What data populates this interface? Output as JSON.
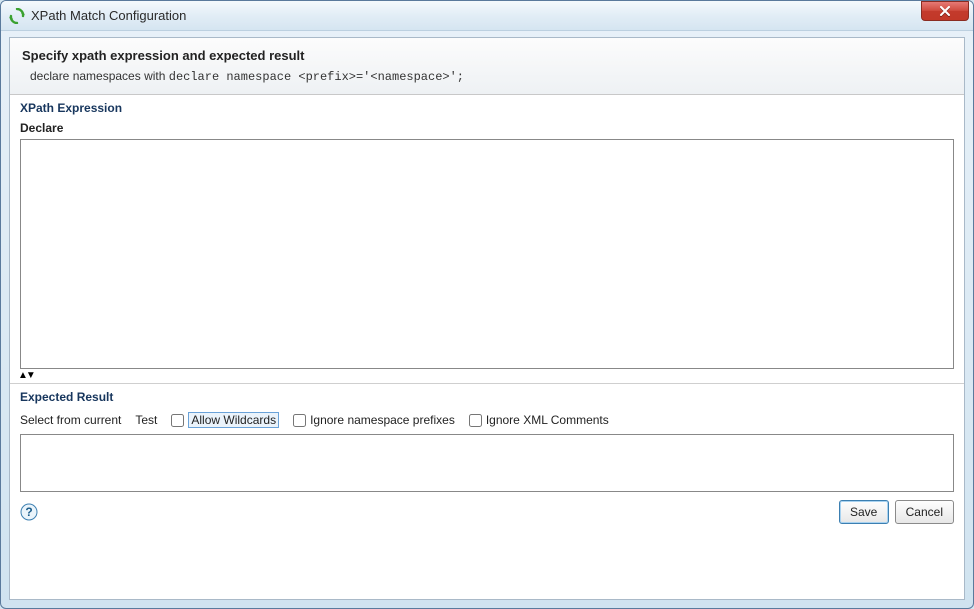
{
  "window": {
    "title": "XPath Match Configuration"
  },
  "header": {
    "title": "Specify xpath expression and expected result",
    "hint_prefix": "declare namespaces with ",
    "hint_code": "declare namespace <prefix>='<namespace>';"
  },
  "xpath_section": {
    "label": "XPath Expression",
    "sublabel": "Declare",
    "value": ""
  },
  "result_section": {
    "label": "Expected Result",
    "select_from_current": "Select from current",
    "test": "Test",
    "allow_wildcards": "Allow Wildcards",
    "ignore_ns": "Ignore namespace prefixes",
    "ignore_comments": "Ignore XML Comments",
    "checks": {
      "allow_wildcards": false,
      "ignore_ns": false,
      "ignore_comments": false
    },
    "value": ""
  },
  "footer": {
    "save": "Save",
    "cancel": "Cancel"
  }
}
